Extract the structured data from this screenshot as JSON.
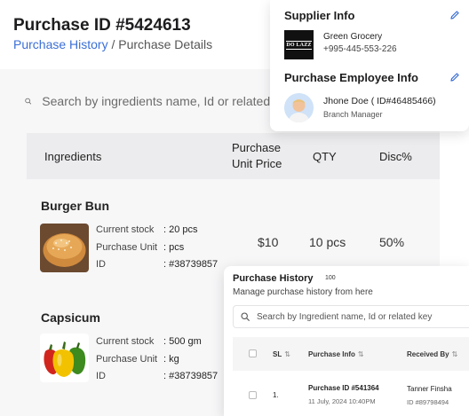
{
  "page": {
    "title": "Purchase ID #5424613",
    "breadcrumb": {
      "link": "Purchase History",
      "separator": " / ",
      "current": "Purchase Details"
    }
  },
  "search": {
    "placeholder": "Search by ingredients name, Id or related k"
  },
  "table": {
    "headers": {
      "ingredients": "Ingredients",
      "price_line1": "Purchase",
      "price_line2": "Unit Price",
      "qty": "QTY",
      "disc": "Disc%"
    },
    "meta_labels": {
      "stock": "Current stock",
      "unit": "Purchase Unit",
      "id": "ID"
    },
    "rows": [
      {
        "name": "Burger Bun",
        "stock": ": 20 pcs",
        "unit": ": pcs",
        "id": ": #38739857",
        "price": "$10",
        "qty": "10 pcs",
        "disc": "50%"
      },
      {
        "name": "Capsicum",
        "stock": ": 500 gm",
        "unit": ": kg",
        "id": ": #38739857"
      }
    ]
  },
  "supplier": {
    "title": "Supplier Info",
    "logo_text": "DO LAZZ",
    "name": "Green Grocery",
    "phone": "+995-445-553-226"
  },
  "employee": {
    "title": "Purchase Employee Info",
    "name": "Jhone Doe ( ID#46485466)",
    "role": "Branch Manager"
  },
  "history": {
    "title": "Purchase History",
    "count": "100",
    "subtitle": "Manage purchase history from here",
    "search_placeholder": "Search by Ingredient name, Id or related key",
    "headers": {
      "sl": "SL",
      "info": "Purchase Info",
      "received": "Received By"
    },
    "rows": [
      {
        "sl": "1.",
        "purchase_id": "Purchase ID #541364",
        "date": "11 July, 2024 10:40PM",
        "received_by": "Tanner Finsha",
        "received_id": "ID #89798494"
      }
    ]
  },
  "colors": {
    "accent": "#3b6fd6",
    "panel_bg": "#f7f7f8",
    "header_bg": "#ececee"
  },
  "icons": {
    "search": "search-icon",
    "edit": "pencil-icon",
    "sort": "sort-icon"
  }
}
